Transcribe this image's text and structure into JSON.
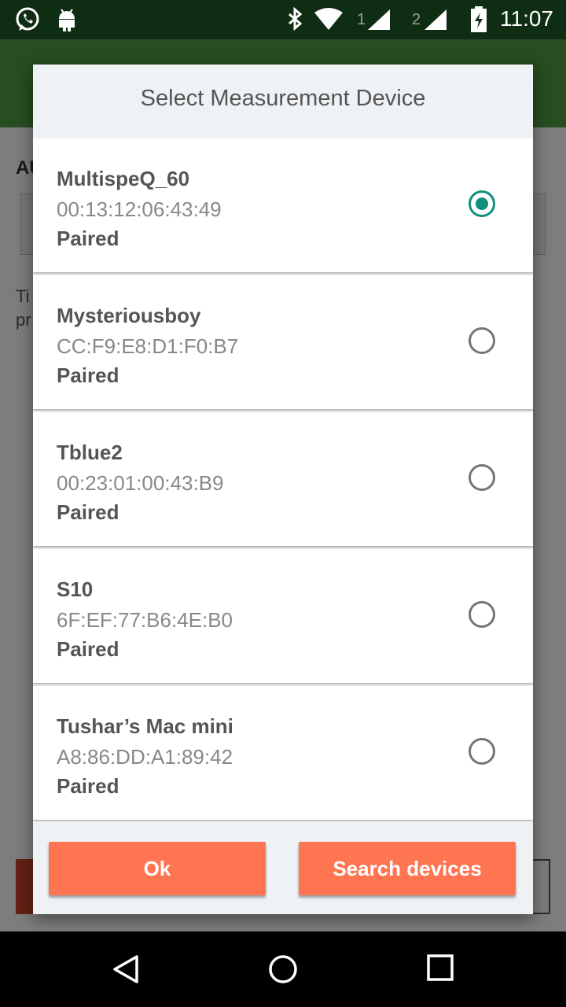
{
  "status_bar": {
    "time": "11:07",
    "sim1_label": "1",
    "sim2_label": "2",
    "icons": [
      "whatsapp-icon",
      "android-icon",
      "bluetooth-icon",
      "wifi-icon",
      "signal-icon",
      "signal-icon",
      "battery-charging-icon"
    ]
  },
  "dialog": {
    "title": "Select Measurement Device",
    "devices": [
      {
        "name": "MultispeQ_60",
        "address": "00:13:12:06:43:49",
        "status": "Paired",
        "selected": true
      },
      {
        "name": "Mysteriousboy",
        "address": "CC:F9:E8:D1:F0:B7",
        "status": "Paired",
        "selected": false
      },
      {
        "name": "Tblue2",
        "address": "00:23:01:00:43:B9",
        "status": "Paired",
        "selected": false
      },
      {
        "name": "S10",
        "address": "6F:EF:77:B6:4E:B0",
        "status": "Paired",
        "selected": false
      },
      {
        "name": "Tushar’s Mac mini",
        "address": "A8:86:DD:A1:89:42",
        "status": "Paired",
        "selected": false
      }
    ],
    "buttons": {
      "ok": "Ok",
      "search": "Search devices"
    }
  },
  "background_app": {
    "heading": "AU",
    "hint_line1": "Ti",
    "hint_line2": "pr"
  },
  "colors": {
    "accent": "#10907c",
    "button": "#ff7552",
    "toolbar": "#4f9a42"
  }
}
